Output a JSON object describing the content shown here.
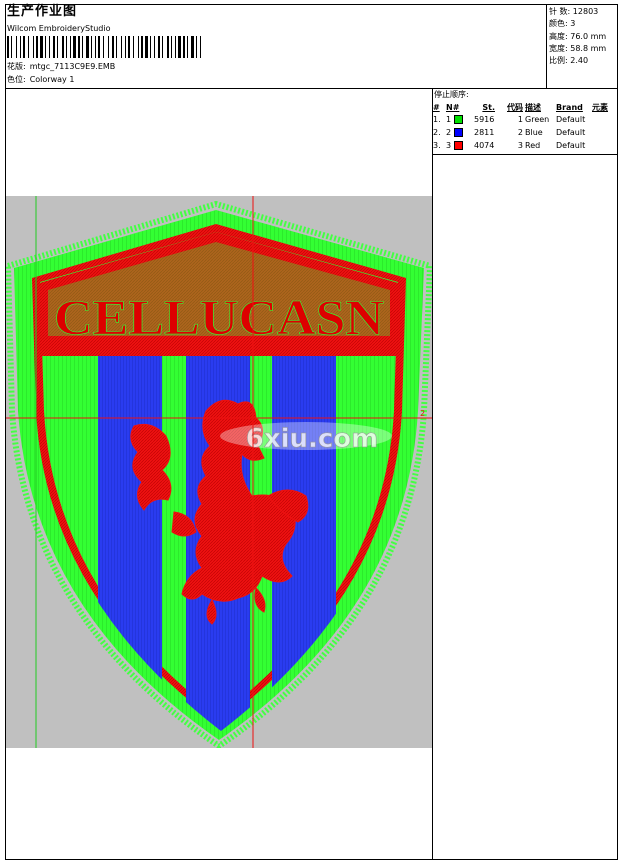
{
  "header": {
    "title": "生产作业图",
    "software": "Wilcom EmbroideryStudio",
    "design_label": "花版:",
    "design_name": "mtgc_7113C9E9.EMB",
    "colorway_label": "色位:",
    "colorway": "Colorway 1"
  },
  "stats": [
    {
      "label": "针 数:",
      "value": "12803"
    },
    {
      "label": "颜色:",
      "value": "3"
    },
    {
      "label": "高度:",
      "value": "76.0 mm"
    },
    {
      "label": "宽度:",
      "value": "58.8 mm"
    },
    {
      "label": "比例:",
      "value": "2.40"
    }
  ],
  "stop_sequence": {
    "title": "停止顺序:",
    "headers": [
      "#",
      "N#",
      "St.",
      "代码",
      "描述",
      "Brand",
      "元素"
    ],
    "rows": [
      {
        "num": "1.",
        "n": "1",
        "color": "#00e000",
        "stitches": "5916",
        "code": "1",
        "desc": "Green",
        "brand": "Default"
      },
      {
        "num": "2.",
        "n": "2",
        "color": "#0000ff",
        "stitches": "2811",
        "code": "2",
        "desc": "Blue",
        "brand": "Default"
      },
      {
        "num": "3.",
        "n": "3",
        "color": "#ff0000",
        "stitches": "4074",
        "code": "3",
        "desc": "Red",
        "brand": "Default"
      }
    ]
  },
  "design": {
    "logo_text": "CELLUCASN",
    "watermark": "6xiu.com",
    "axis_marker": "2",
    "colors": {
      "green": "#33ff33",
      "blue": "#2a3cf0",
      "red": "#ee1111",
      "background": "#c0c0c0"
    }
  }
}
